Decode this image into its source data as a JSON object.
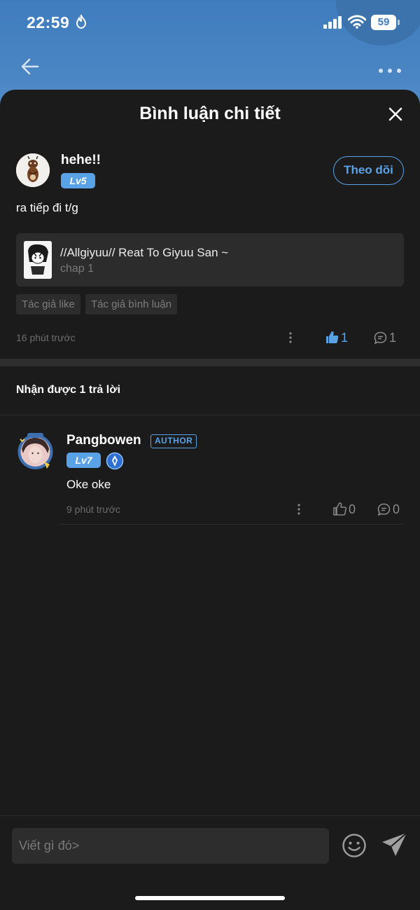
{
  "status_bar": {
    "time": "22:59",
    "battery": "59"
  },
  "header": {
    "title": "Bình luận chi tiết"
  },
  "comment": {
    "username": "hehe!!",
    "level": "Lv5",
    "follow_label": "Theo dõi",
    "text": "ra tiếp đi t/g",
    "story": {
      "title": "//Allgiyuu// Reat To Giyuu San ~",
      "chapter": "chap 1"
    },
    "tags": [
      "Tác giả like",
      "Tác giả bình luận"
    ],
    "time": "16 phút trước",
    "likes": "1",
    "replies": "1"
  },
  "replies_header": "Nhận được 1 trả lời",
  "reply": {
    "username": "Pangbowen",
    "badge": "AUTHOR",
    "level": "Lv7",
    "text": "Oke oke",
    "time": "9 phút trước",
    "likes": "0",
    "replies": "0"
  },
  "input": {
    "placeholder": "Viết gì đó>"
  },
  "colors": {
    "accent": "#5aa2e6",
    "background": "#1b1b1b",
    "card": "#2c2c2c",
    "header_blue": "#3f7cbe"
  }
}
